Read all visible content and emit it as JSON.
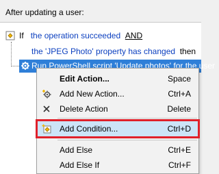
{
  "header": {
    "label": "After updating a user:"
  },
  "rule": {
    "if_keyword": "If",
    "condition1": "the operation succeeded",
    "and_keyword": "AND",
    "condition2": "the 'JPEG Photo' property has changed",
    "then_keyword": "then",
    "action": "Run PowerShell script 'Update photos' for the user"
  },
  "context_menu": {
    "items": [
      {
        "label": "Edit Action...",
        "shortcut": "Space",
        "icon": "none"
      },
      {
        "label": "Add New Action...",
        "shortcut": "Ctrl+A",
        "icon": "gear-plus-icon"
      },
      {
        "label": "Delete Action",
        "shortcut": "Delete",
        "icon": "close-icon"
      },
      {
        "label": "Add Condition...",
        "shortcut": "Ctrl+D",
        "icon": "condition-plus-icon"
      },
      {
        "label": "Add Else",
        "shortcut": "Ctrl+E",
        "icon": "none"
      },
      {
        "label": "Add Else If",
        "shortcut": "Ctrl+F",
        "icon": "none"
      }
    ]
  },
  "colors": {
    "selection": "#2f7fd8",
    "condition_text": "#0b3fbf",
    "highlight_border": "#e0202a",
    "menu_hover": "#cce4f7"
  }
}
